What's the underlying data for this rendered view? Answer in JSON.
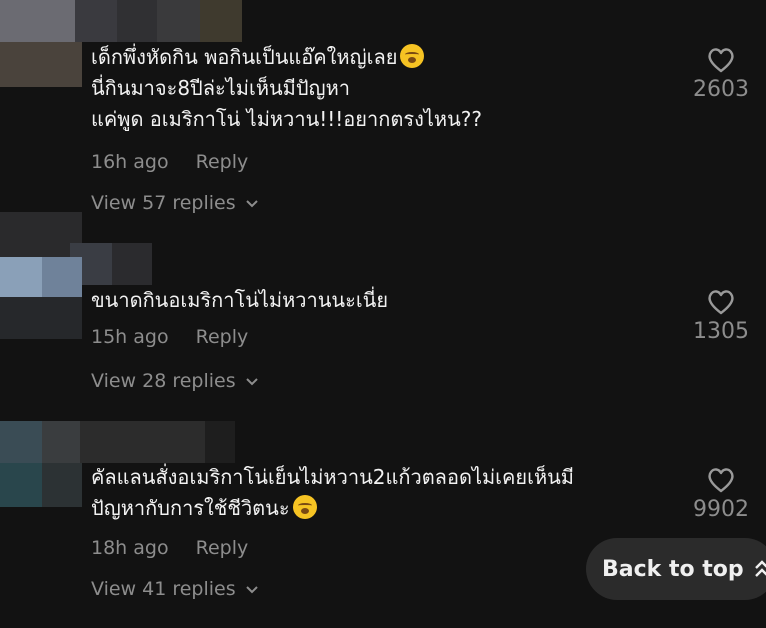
{
  "comments": [
    {
      "lines": [
        "เด็กพึ่งหัดกิน พอกินเป็นแอ๊คใหญ่เลย",
        "นี่กินมาจะ8ปีล่ะไม่เห็นมีปัญหา",
        "แค่พูด อเมริกาโน่ ไม่หวาน!!!อยากตรงไหน??"
      ],
      "time": "16h ago",
      "reply": "Reply",
      "view_replies": "View 57 replies",
      "likes": "2603",
      "emoji": "sleepy-face-emoji",
      "avatar_colors": [
        "#6b6b72",
        "#3a3a3f",
        "#4a433c",
        "#2d2d2f",
        "#3f3a2e"
      ]
    },
    {
      "lines": [
        "ขนาดกินอเมริกาโน่ไม่หวานนะเนี่ย"
      ],
      "time": "15h ago",
      "reply": "Reply",
      "view_replies": "View 28 replies",
      "likes": "1305",
      "avatar_colors": [
        "#2a2a2c",
        "#8aa0b8",
        "#3a3d44",
        "#2b2b2e",
        "#26282b"
      ]
    },
    {
      "lines": [
        "คัลแลนสั่งอเมริกาโน่เย็นไม่หวาน2แก้วตลอดไม่เคยเห็นมี",
        "ปัญหากับการใช้ชีวิตนะ"
      ],
      "time": "18h ago",
      "reply": "Reply",
      "view_replies": "View 41 replies",
      "likes": "9902",
      "emoji": "rolling-laughing-emoji",
      "avatar_colors": [
        "#3a4c55",
        "#2f3f45",
        "#2c3234",
        "#29464c",
        "#2c2c2c"
      ]
    }
  ],
  "back_to_top": "Back to top",
  "back_to_top_icon": "double-chevron-up-icon"
}
